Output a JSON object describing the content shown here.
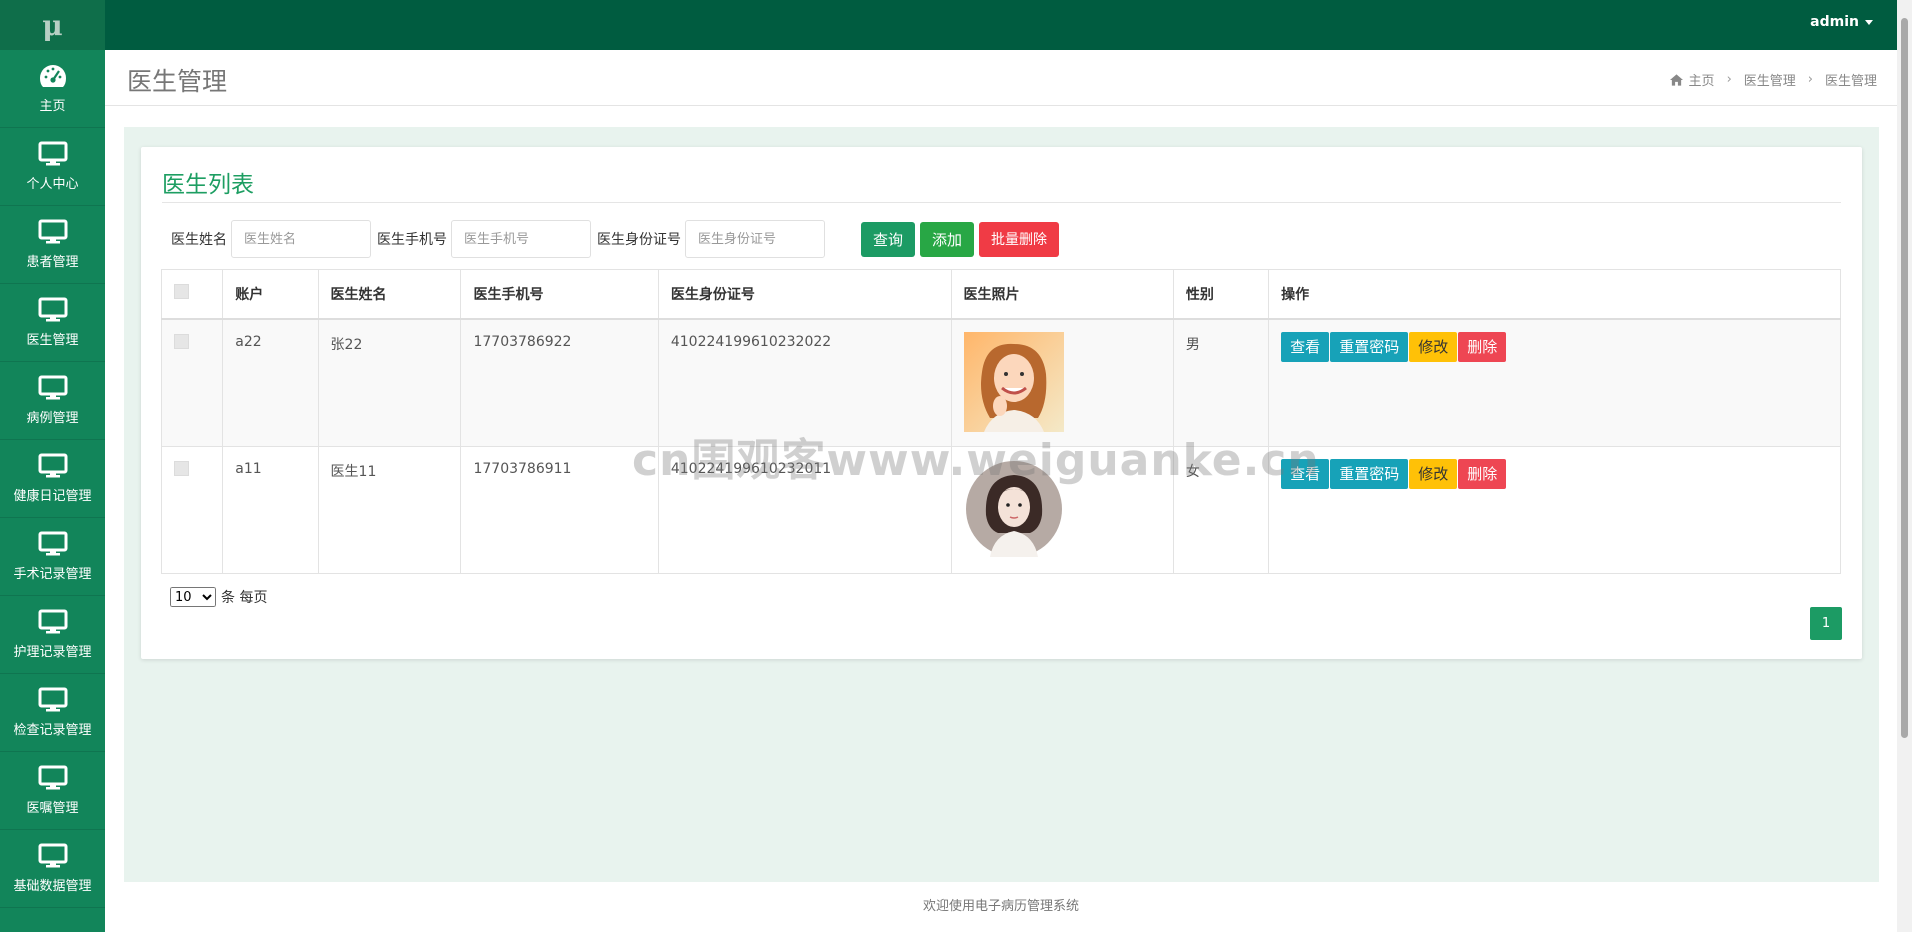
{
  "logo": "μ",
  "sidebar": {
    "items": [
      {
        "label": "主页",
        "icon": "dashboard-icon"
      },
      {
        "label": "个人中心",
        "icon": "monitor-icon"
      },
      {
        "label": "患者管理",
        "icon": "monitor-icon"
      },
      {
        "label": "医生管理",
        "icon": "monitor-icon"
      },
      {
        "label": "病例管理",
        "icon": "monitor-icon"
      },
      {
        "label": "健康日记管理",
        "icon": "monitor-icon"
      },
      {
        "label": "手术记录管理",
        "icon": "monitor-icon"
      },
      {
        "label": "护理记录管理",
        "icon": "monitor-icon"
      },
      {
        "label": "检查记录管理",
        "icon": "monitor-icon"
      },
      {
        "label": "医嘱管理",
        "icon": "monitor-icon"
      },
      {
        "label": "基础数据管理",
        "icon": "monitor-icon"
      }
    ]
  },
  "topbar": {
    "user": "admin"
  },
  "header": {
    "title": "医生管理",
    "breadcrumb": [
      "主页",
      "医生管理",
      "医生管理"
    ]
  },
  "panel": {
    "title": "医生列表"
  },
  "search": {
    "name_label": "医生姓名",
    "name_placeholder": "医生姓名",
    "phone_label": "医生手机号",
    "phone_placeholder": "医生手机号",
    "id_label": "医生身份证号",
    "id_placeholder": "医生身份证号",
    "query_button": "查询",
    "add_button": "添加",
    "batch_delete_button": "批量删除"
  },
  "table": {
    "headers": [
      "账户",
      "医生姓名",
      "医生手机号",
      "医生身份证号",
      "医生照片",
      "性别",
      "操作"
    ],
    "rows": [
      {
        "account": "a22",
        "name": "张22",
        "phone": "17703786922",
        "id_number": "410224199610232022",
        "gender": "男"
      },
      {
        "account": "a11",
        "name": "医生11",
        "phone": "17703786911",
        "id_number": "410224199610232011",
        "gender": "女"
      }
    ],
    "actions": {
      "view": "查看",
      "reset": "重置密码",
      "edit": "修改",
      "delete": "删除"
    }
  },
  "pagination": {
    "page_size": "10",
    "page_size_options": [
      "10"
    ],
    "per_page_text": "条 每页",
    "current_page": "1"
  },
  "footer": "欢迎使用电子病历管理系统",
  "watermark": "cn围观客www.weiguanke.cn",
  "colors": {
    "sidebar": "#12855a",
    "topbar": "#005c40",
    "accent": "#1d9e62",
    "danger": "#f03b45",
    "info": "#17a2b8",
    "warning": "#ffc107"
  }
}
